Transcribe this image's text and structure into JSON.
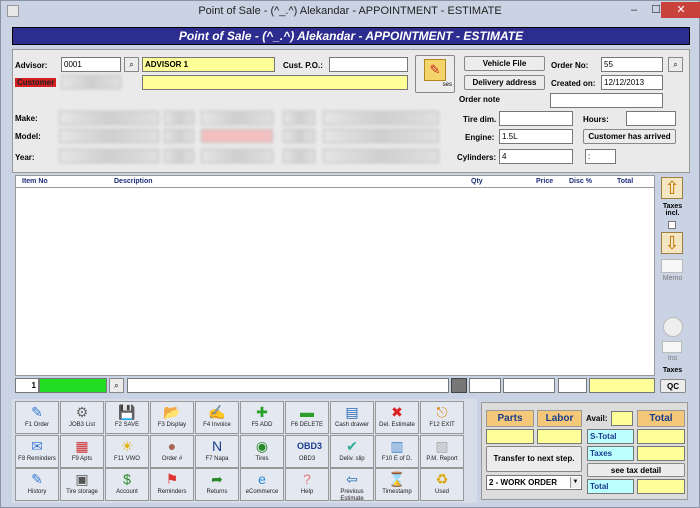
{
  "window": {
    "title": "Point of Sale - (^_.^) Alekandar - APPOINTMENT - ESTIMATE",
    "min": "–",
    "max": "☐",
    "close": "✕"
  },
  "banner": "Point of Sale - (^_.^) Alekandar - APPOINTMENT - ESTIMATE",
  "form": {
    "advisor_label": "Advisor:",
    "advisor_code": "0001",
    "advisor_name": "ADVISOR 1",
    "customer_label": "Customer",
    "cust_po_label": "Cust. P.O.:",
    "cust_po_value": "",
    "make_label": "Make:",
    "model_label": "Model:",
    "year_label": "Year:",
    "vehicle_file": "Vehicle File",
    "delivery_address": "Delivery address",
    "order_no_label": "Order No:",
    "order_no_value": "55",
    "created_on_label": "Created on:",
    "created_on_value": "12/12/2013",
    "order_note_label": "Order note",
    "tire_dim_label": "Tire dim.",
    "hours_label": "Hours:",
    "engine_label": "Engine:",
    "engine_value": "1.5L",
    "customer_arrived": "Customer has arrived",
    "cylinders_label": "Cylinders:",
    "cylinders_value": "4",
    "colon_value": ":",
    "history_icon_label": "ses"
  },
  "grid": {
    "headers": [
      "Item No",
      "Description",
      "Qty",
      "Price",
      "Disc %",
      "Total"
    ]
  },
  "side": {
    "taxes_incl": "Taxes incl.",
    "memo": "Memo",
    "ins": "Ins",
    "taxes": "Taxes",
    "qc": "QC"
  },
  "bottom_row": {
    "line_no": "1"
  },
  "fkeys": [
    {
      "label": "F1 Order",
      "icon": "✎",
      "color": "#3a7bd5"
    },
    {
      "label": "JOB3 List",
      "icon": "⚙",
      "color": "#666"
    },
    {
      "label": "F2 SAVE",
      "icon": "💾",
      "color": "#444"
    },
    {
      "label": "F3 Display",
      "icon": "📂",
      "color": "#d9a400"
    },
    {
      "label": "F4 Invoice",
      "icon": "✍",
      "color": "#c77"
    },
    {
      "label": "F5 ADD",
      "icon": "✚",
      "color": "#2aa02a"
    },
    {
      "label": "F6 DELETE",
      "icon": "▬",
      "color": "#2aa02a"
    },
    {
      "label": "Cash drawer",
      "icon": "▤",
      "color": "#2a6ab5"
    },
    {
      "label": "Del. Estimate",
      "icon": "✖",
      "color": "#d22"
    },
    {
      "label": "F12 EXIT",
      "icon": "⎋",
      "color": "#d98000"
    },
    {
      "label": "F8 Reminders",
      "icon": "✉",
      "color": "#3a7bd5"
    },
    {
      "label": "F9 Apts",
      "icon": "▦",
      "color": "#c33"
    },
    {
      "label": "F11 VWO",
      "icon": "☀",
      "color": "#e0b000"
    },
    {
      "label": "Order #",
      "icon": "●",
      "color": "#a65"
    },
    {
      "label": "F7 Napa",
      "icon": "N",
      "color": "#1a3d8f"
    },
    {
      "label": "Tires",
      "icon": "◉",
      "color": "#2a8a2a"
    },
    {
      "label": "OBD3",
      "icon": "OBD3",
      "color": "#1a3d8f"
    },
    {
      "label": "Deliv. slip",
      "icon": "✔",
      "color": "#3a9"
    },
    {
      "label": "F10 E of D.",
      "icon": "▥",
      "color": "#48c"
    },
    {
      "label": "P.M. Report",
      "icon": "▧",
      "color": "#aaa"
    },
    {
      "label": "History",
      "icon": "✎",
      "color": "#3a7bd5"
    },
    {
      "label": "Tire storage",
      "icon": "▣",
      "color": "#555"
    },
    {
      "label": "Account",
      "icon": "$",
      "color": "#2a8a2a"
    },
    {
      "label": "Reminders",
      "icon": "⚑",
      "color": "#d33"
    },
    {
      "label": "Returns",
      "icon": "➦",
      "color": "#2a8a2a"
    },
    {
      "label": "eCommerce",
      "icon": "e",
      "color": "#2a8ad8"
    },
    {
      "label": "Help",
      "icon": "?",
      "color": "#d77"
    },
    {
      "label": "Previous Estimate",
      "icon": "⇦",
      "color": "#2a6ab5"
    },
    {
      "label": "Timestamp",
      "icon": "⌛",
      "color": "#555"
    },
    {
      "label": "Used",
      "icon": "♻",
      "color": "#d9a400"
    }
  ],
  "totals": {
    "parts": "Parts",
    "labor": "Labor",
    "avail": "Avail:",
    "total_header": "Total",
    "s_total": "S-Total",
    "taxes": "Taxes",
    "transfer": "Transfer to next step.",
    "see_tax_detail": "see tax detail",
    "select_value": "2 - WORK ORDER",
    "total": "Total"
  }
}
